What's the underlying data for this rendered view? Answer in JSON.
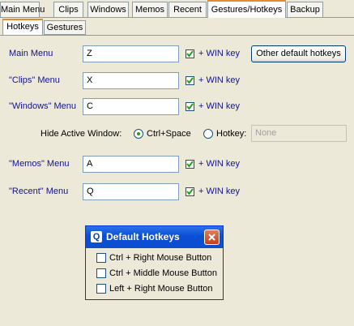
{
  "tabs": [
    "Main Menu",
    "Clips",
    "Windows",
    "Memos",
    "Recent",
    "Gestures/Hotkeys",
    "Backup"
  ],
  "subtabs": [
    "Hotkeys",
    "Gestures"
  ],
  "rows": {
    "main": {
      "label": "Main Menu",
      "value": "Z"
    },
    "clips": {
      "label": "\"Clips\" Menu",
      "value": "X"
    },
    "windows": {
      "label": "\"Windows\" Menu",
      "value": "C"
    },
    "memos": {
      "label": "\"Memos\" Menu",
      "value": "A"
    },
    "recent": {
      "label": "\"Recent\" Menu",
      "value": "Q"
    }
  },
  "win_key_label": "+ WIN key",
  "other_button": "Other default hotkeys",
  "hide_window": {
    "label": "Hide Active Window:",
    "option1": "Ctrl+Space",
    "option2": "Hotkey:",
    "hotkey_value": "None"
  },
  "popup": {
    "icon": "Q",
    "title": "Default Hotkeys",
    "items": [
      "Ctrl + Right Mouse Button",
      "Ctrl + Middle Mouse Button",
      "Left + Right Mouse Button"
    ]
  }
}
